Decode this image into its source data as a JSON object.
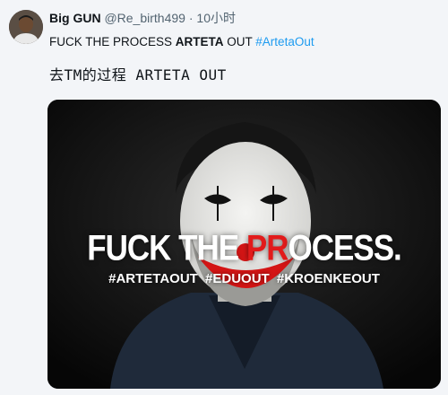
{
  "author": {
    "name": "Big GUN",
    "handle": "@Re_birth499",
    "separator": "·",
    "time": "10小时"
  },
  "tweet": {
    "line1_prefix": "FUCK THE PROCESS ",
    "line1_bold": "ARTETA",
    "line1_mid": " OUT ",
    "line1_hashtag": "#ArtetaOut",
    "line2": "去TM的过程 ARTETA OUT"
  },
  "media": {
    "title_before": "FUCK THE ",
    "title_highlight": "PR",
    "title_after": "OCESS.",
    "hashtags": "#ARTETAOUT #EDUOUT #KROENKEOUT"
  },
  "colors": {
    "hashtag": "#1d9bf0",
    "highlight": "#e21b1b",
    "background": "#f3f5f8"
  }
}
